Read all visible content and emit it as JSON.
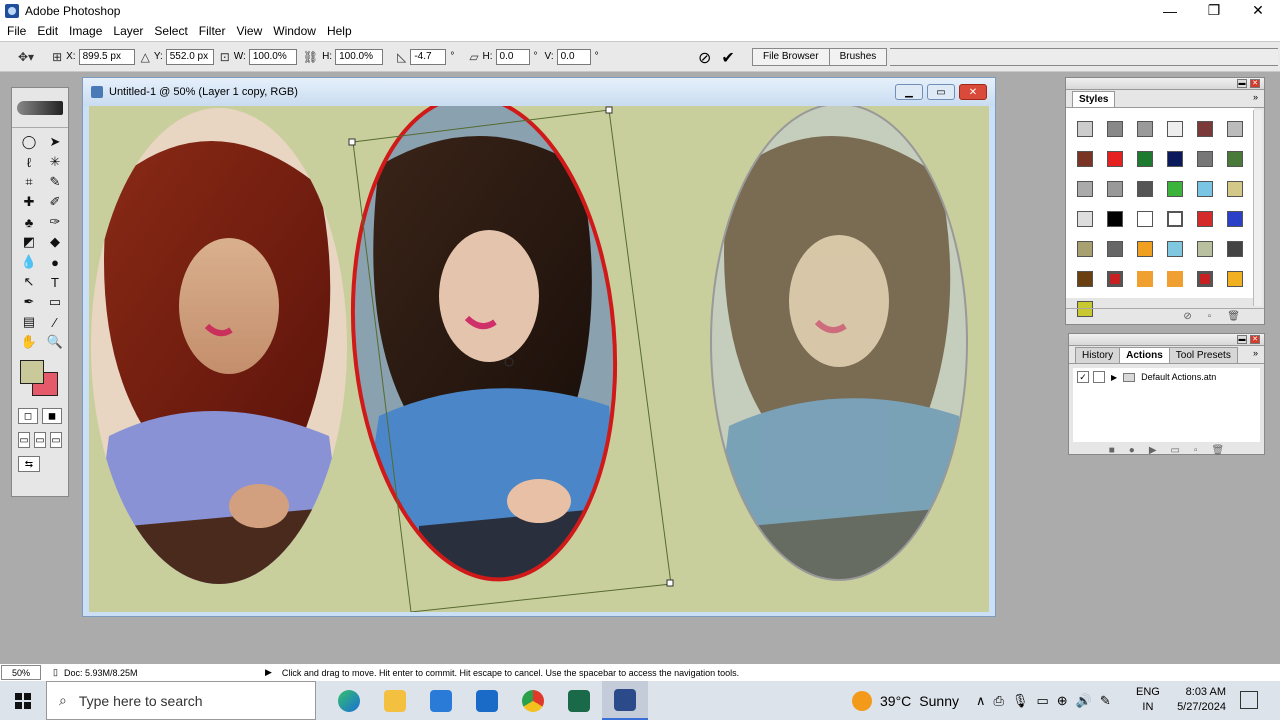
{
  "app": {
    "title": "Adobe Photoshop",
    "minimize": "—",
    "maximize": "❐",
    "close": "✕"
  },
  "menu": [
    "File",
    "Edit",
    "Image",
    "Layer",
    "Select",
    "Filter",
    "View",
    "Window",
    "Help"
  ],
  "options": {
    "x_label": "X:",
    "x_value": "899.5 px",
    "y_label": "Y:",
    "y_value": "552.0 px",
    "w_label": "W:",
    "w_value": "100.0%",
    "h_label": "H:",
    "h_value": "100.0%",
    "angle_value": "-4.7",
    "skew_h_label": "H:",
    "skew_h_value": "0.0",
    "skew_v_label": "V:",
    "skew_v_value": "0.0",
    "degree": "°"
  },
  "palette_well": {
    "tab1": "File Browser",
    "tab2": "Brushes"
  },
  "document": {
    "title": "Untitled-1 @ 50% (Layer 1 copy, RGB)"
  },
  "styles_palette": {
    "tab": "Styles"
  },
  "actions_palette": {
    "tabs": [
      "History",
      "Actions",
      "Tool Presets"
    ],
    "set_name": "Default Actions.atn"
  },
  "status": {
    "zoom": "50%",
    "doc_size": "Doc: 5.93M/8.25M",
    "hint": "Click and drag to move. Hit enter to commit. Hit escape to cancel. Use the spacebar to access the navigation tools."
  },
  "taskbar": {
    "search_placeholder": "Type here to search",
    "weather_temp": "39°C",
    "weather_text": "Sunny",
    "lang_top": "ENG",
    "lang_bottom": "IN",
    "time": "8:03 AM",
    "date": "5/27/2024"
  },
  "colors": {
    "canvas": "#c9cf9c",
    "foreground": "#c9c99a",
    "background": "#e45a6a",
    "selection_border": "#d01a1a"
  }
}
